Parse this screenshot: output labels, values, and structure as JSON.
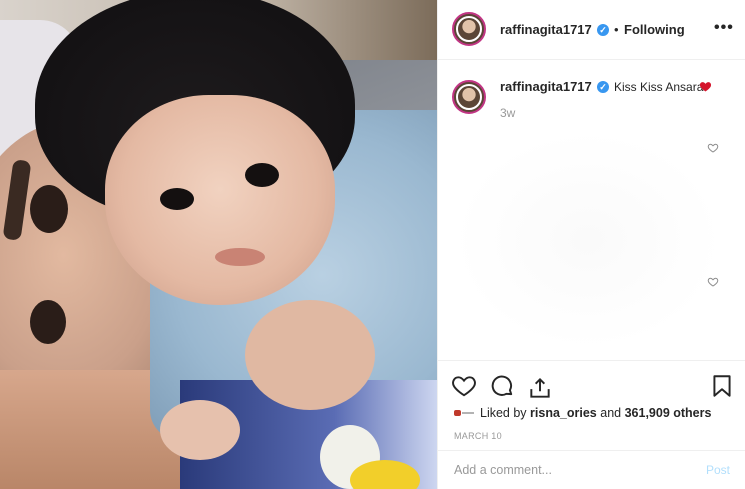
{
  "post": {
    "username": "raffinagita1717",
    "separator": "•",
    "following_label": "Following",
    "more_label": "•••"
  },
  "caption": {
    "username": "raffinagita1717",
    "text": "Kiss Kiss Ansara",
    "time_ago": "3w"
  },
  "engagement": {
    "liked_by_prefix": "Liked by",
    "liked_by_user": "risna_ories",
    "and_label": "and",
    "others_label": "361,909 others",
    "date": "MARCH 10"
  },
  "comment": {
    "placeholder": "Add a comment...",
    "post_label": "Post"
  },
  "icons": {
    "verified": "verified-badge-icon",
    "heart": "heart-icon",
    "comment": "comment-icon",
    "share": "share-icon",
    "save": "bookmark-icon"
  },
  "colors": {
    "verified_blue": "#3897f0",
    "post_button_disabled": "#b2dffc",
    "emoji_heart": "#d4152c"
  }
}
